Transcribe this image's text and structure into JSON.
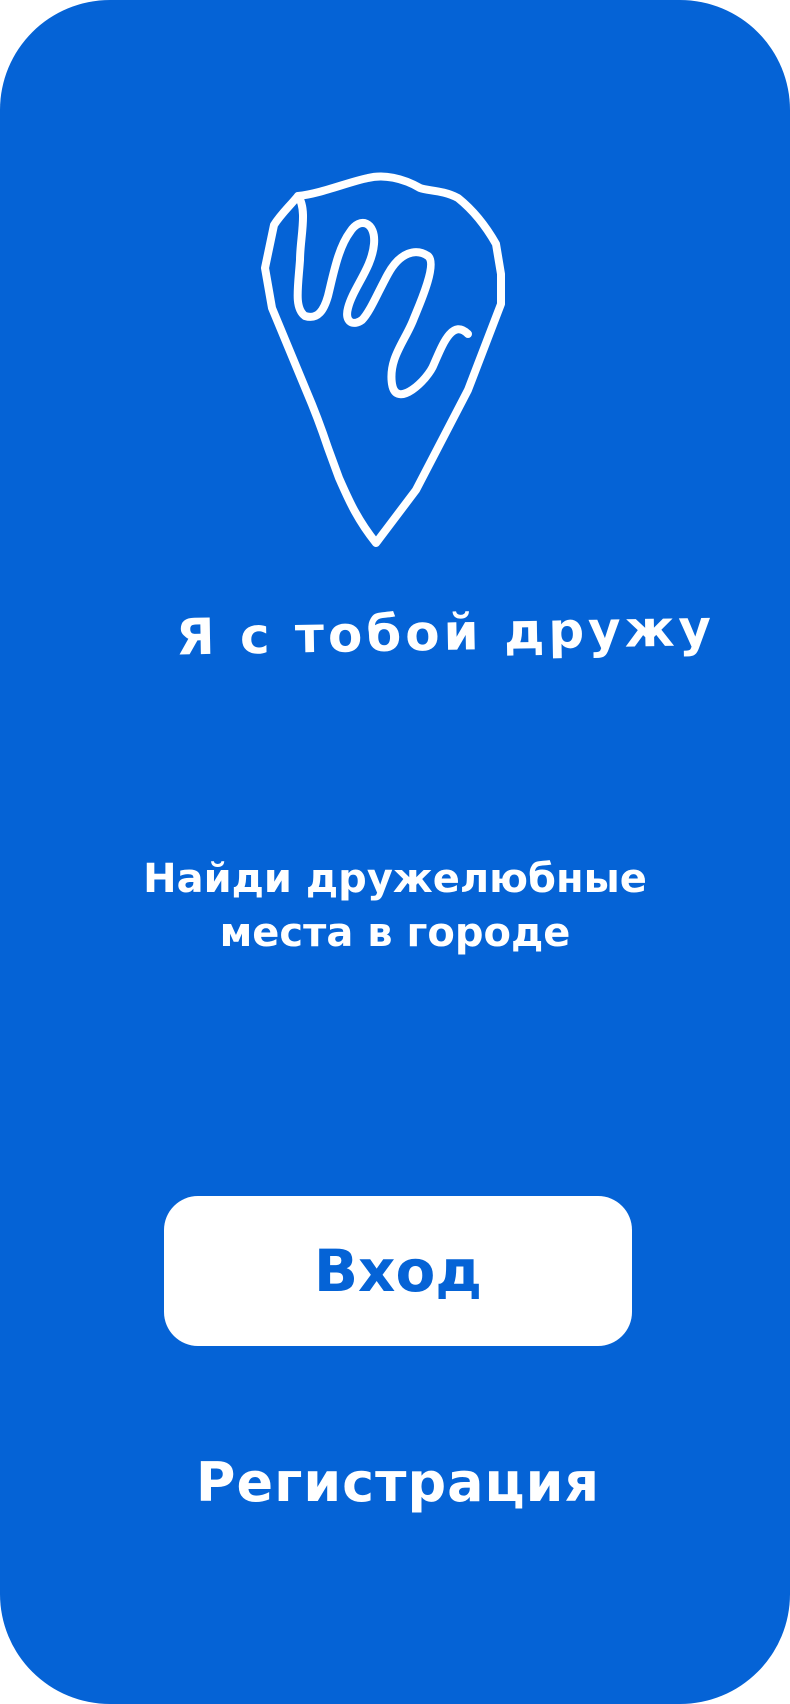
{
  "colors": {
    "background": "#0563D6",
    "foreground": "#FFFFFF",
    "button_background": "#FFFFFF",
    "button_text": "#0563D6"
  },
  "logo": {
    "icon": "map-pin-hand-icon",
    "text": "Я с тобой дружу"
  },
  "tagline": {
    "line1": "Найди дружелюбные",
    "line2": "места в городе"
  },
  "actions": {
    "login_label": "Вход",
    "register_label": "Регистрация"
  }
}
